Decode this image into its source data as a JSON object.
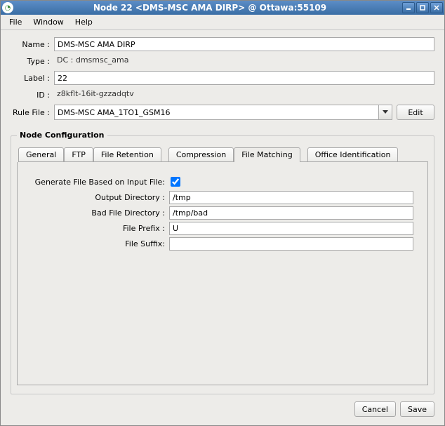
{
  "window": {
    "title": "Node 22 <DMS-MSC AMA DIRP> @ Ottawa:55109"
  },
  "menu": {
    "file": "File",
    "window": "Window",
    "help": "Help"
  },
  "form": {
    "name_label": "Name :",
    "name_value": "DMS-MSC AMA DIRP",
    "type_label": "Type :",
    "type_value": "DC : dmsmsc_ama",
    "label_label": "Label :",
    "label_value": "22",
    "id_label": "ID :",
    "id_value": "z8kflt-16it-gzzadqtv",
    "rulefile_label": "Rule File :",
    "rulefile_value": "DMS-MSC AMA_1TO1_GSM16",
    "edit_button": "Edit"
  },
  "config": {
    "legend": "Node  Configuration",
    "tabs": {
      "general": "General",
      "ftp": "FTP",
      "file_retention": "File Retention",
      "compression": "Compression",
      "file_matching": "File Matching",
      "office_identification": "Office Identification"
    },
    "file_matching": {
      "gen_label": "Generate File Based on Input File:",
      "gen_checked": true,
      "outdir_label": "Output Directory :",
      "outdir_value": "/tmp",
      "baddir_label": "Bad File Directory :",
      "baddir_value": "/tmp/bad",
      "prefix_label": "File Prefix :",
      "prefix_value": "U",
      "suffix_label": "File Suffix:",
      "suffix_value": ""
    }
  },
  "buttons": {
    "cancel": "Cancel",
    "save": "Save"
  }
}
